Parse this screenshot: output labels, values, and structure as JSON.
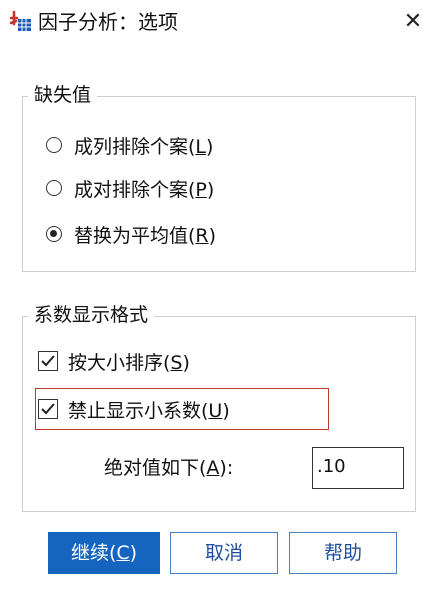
{
  "window": {
    "title": "因子分析：选项",
    "close_glyph": "✕",
    "icon": "factor-analysis-app-icon"
  },
  "missing_values": {
    "title": "缺失值",
    "options": [
      {
        "text": "成列排除个案(",
        "mnemonic": "L",
        "suffix": ")",
        "checked": false
      },
      {
        "text": "成对排除个案(",
        "mnemonic": "P",
        "suffix": ")",
        "checked": false
      },
      {
        "text": "替换为平均值(",
        "mnemonic": "R",
        "suffix": ")",
        "checked": true
      }
    ]
  },
  "coefficient_format": {
    "title": "系数显示格式",
    "sort_by_size": {
      "text": "按大小排序(",
      "mnemonic": "S",
      "suffix": ")",
      "checked": true
    },
    "suppress_small": {
      "text": "禁止显示小系数(",
      "mnemonic": "U",
      "suffix": ")",
      "checked": true
    },
    "abs_below": {
      "text": "绝对值如下(",
      "mnemonic": "A",
      "suffix": "):",
      "value": ".10"
    }
  },
  "buttons": {
    "continue": {
      "text": "继续(",
      "mnemonic": "C",
      "suffix": ")"
    },
    "cancel": "取消",
    "help": "帮助"
  },
  "colors": {
    "primary": "#1565c0",
    "highlight": "#c0392b"
  }
}
